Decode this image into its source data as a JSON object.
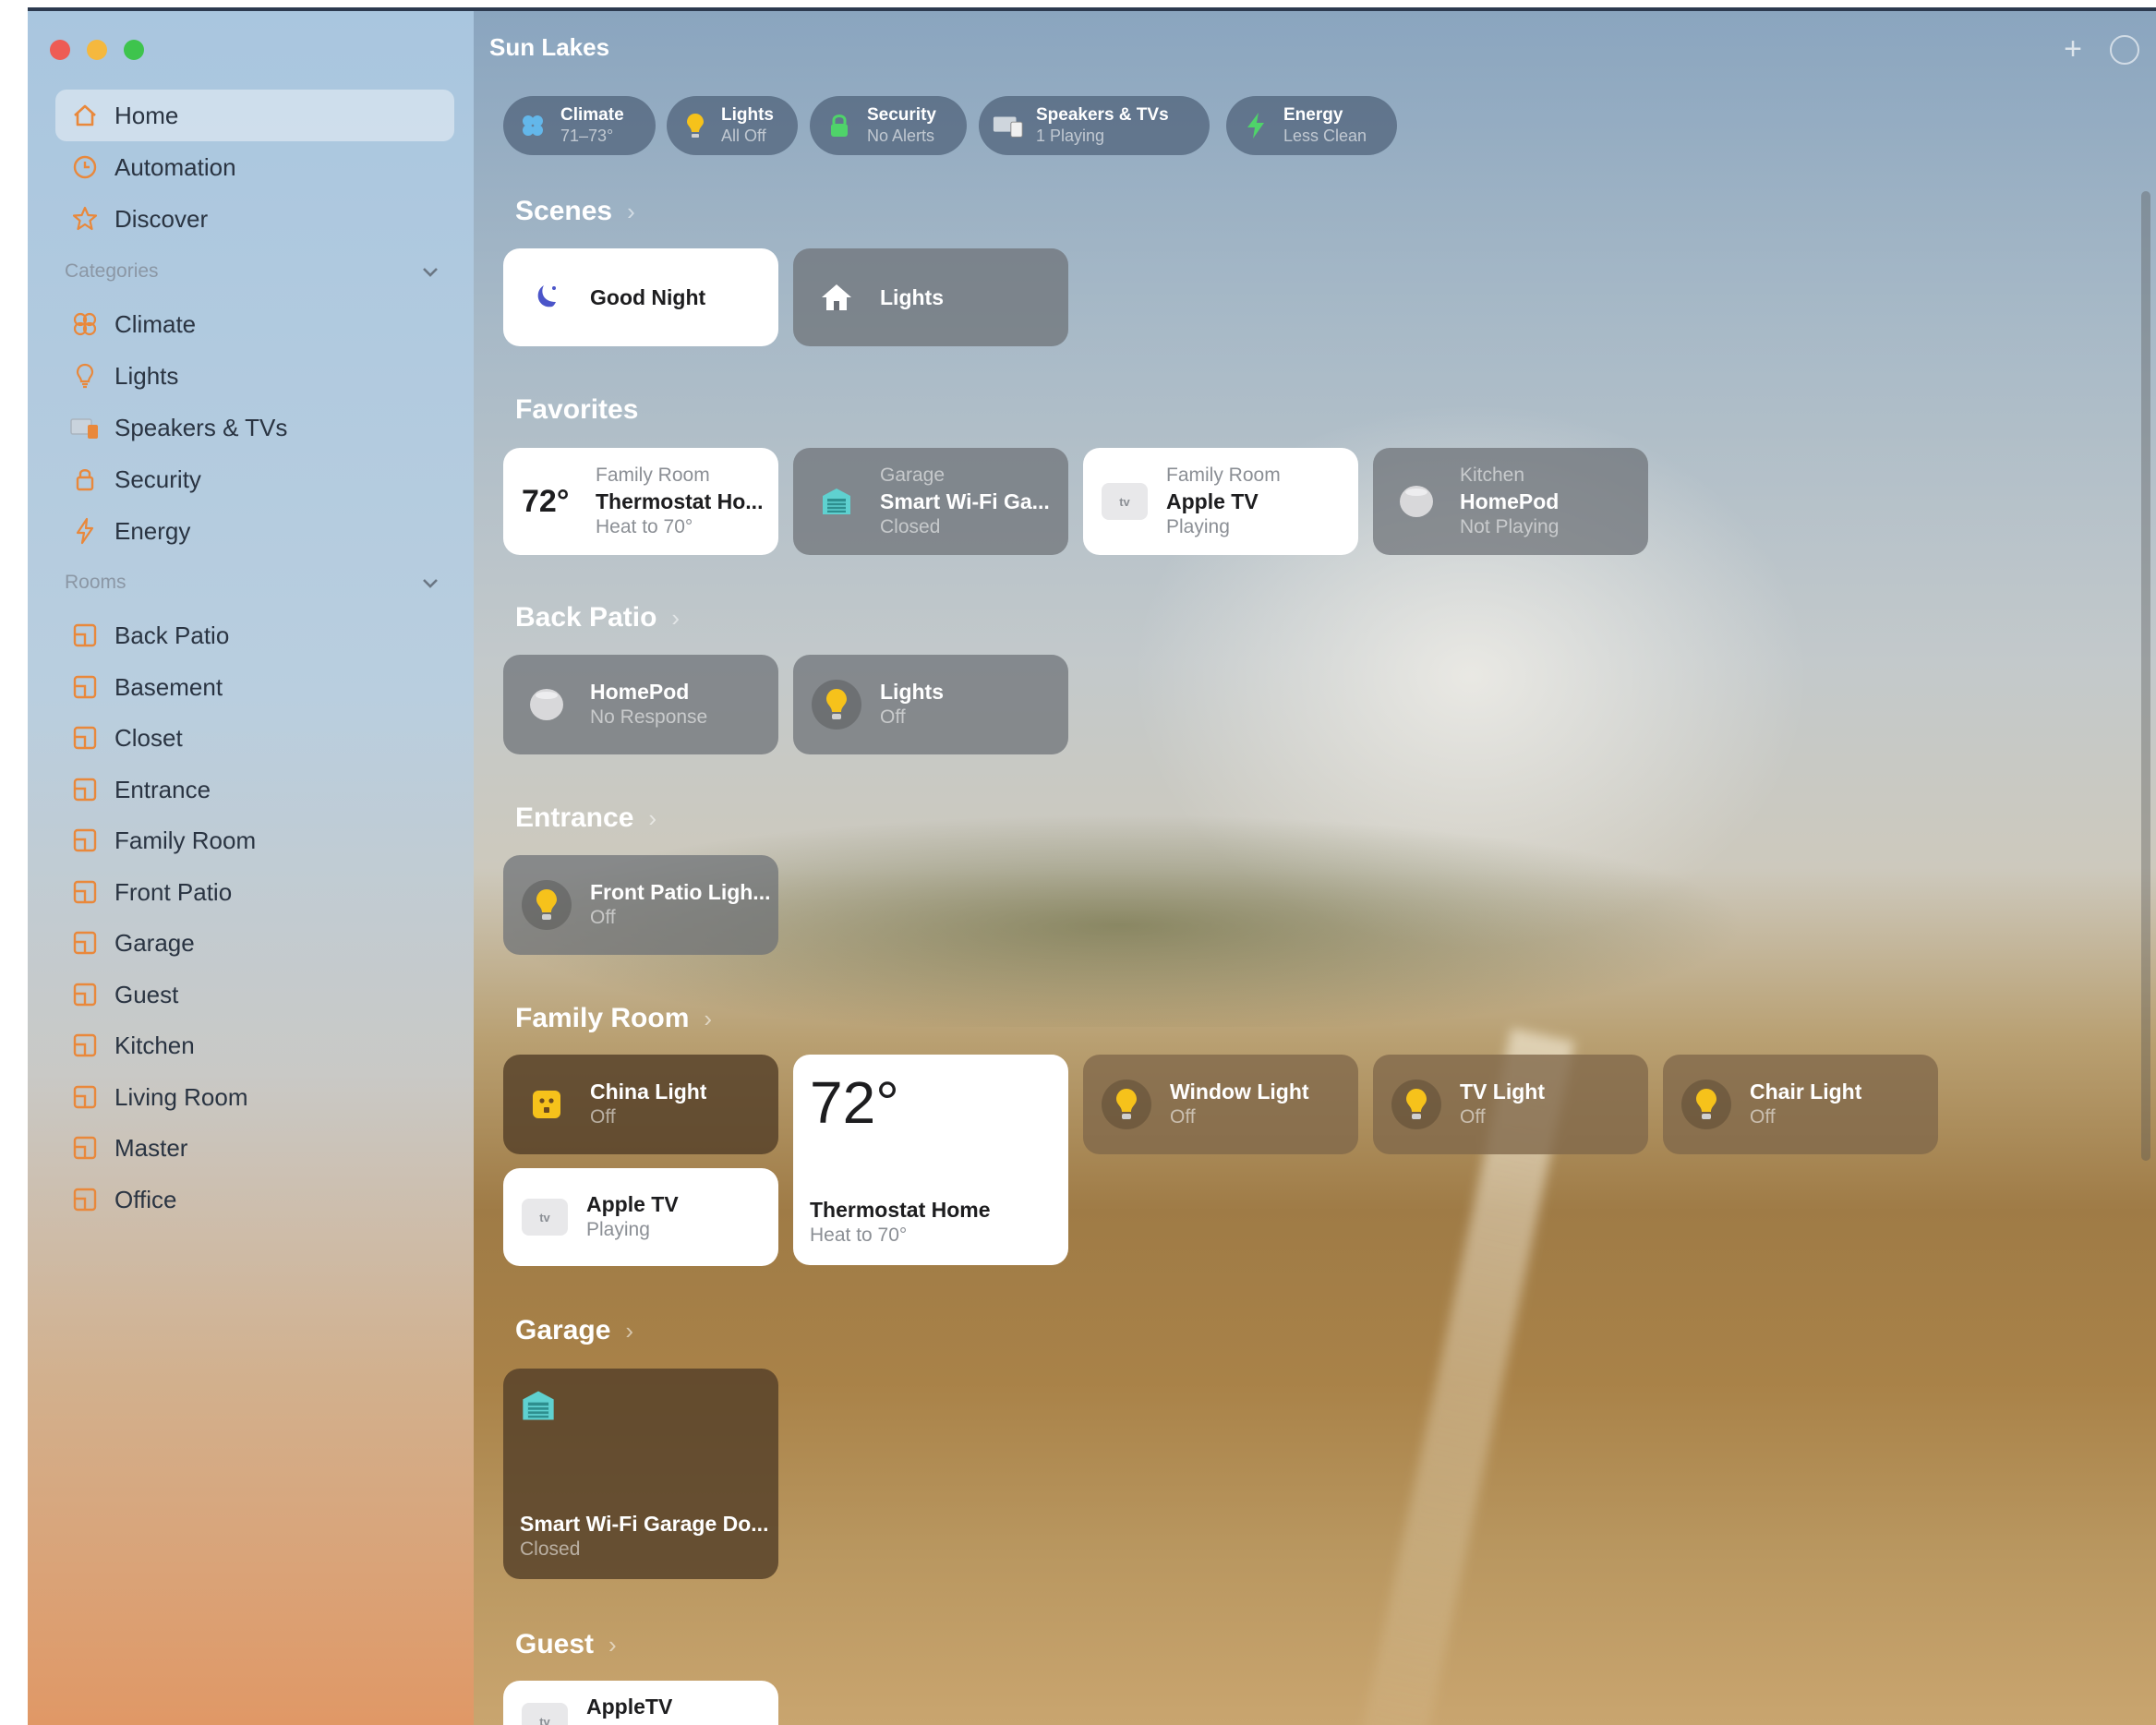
{
  "window": {
    "title": "Sun Lakes"
  },
  "sidebar": {
    "top_items": [
      {
        "label": "Home",
        "icon": "house-icon",
        "active": true
      },
      {
        "label": "Automation",
        "icon": "clock-icon"
      },
      {
        "label": "Discover",
        "icon": "star-icon"
      }
    ],
    "categories_header": "Categories",
    "categories": [
      {
        "label": "Climate",
        "icon": "fan-icon"
      },
      {
        "label": "Lights",
        "icon": "bulb-icon"
      },
      {
        "label": "Speakers & TVs",
        "icon": "speaker-icon"
      },
      {
        "label": "Security",
        "icon": "lock-icon"
      },
      {
        "label": "Energy",
        "icon": "bolt-icon"
      }
    ],
    "rooms_header": "Rooms",
    "rooms": [
      "Back Patio",
      "Basement",
      "Closet",
      "Entrance",
      "Family Room",
      "Front Patio",
      "Garage",
      "Guest",
      "Kitchen",
      "Living Room",
      "Master",
      "Office"
    ]
  },
  "status_pills": [
    {
      "title": "Climate",
      "sub": "71–73°",
      "icon": "fan-icon"
    },
    {
      "title": "Lights",
      "sub": "All Off",
      "icon": "bulb-icon"
    },
    {
      "title": "Security",
      "sub": "No Alerts",
      "icon": "lock-icon"
    },
    {
      "title": "Speakers & TVs",
      "sub": "1 Playing",
      "icon": "speaker-icon"
    },
    {
      "title": "Energy",
      "sub": "Less Clean",
      "icon": "bolt-icon"
    }
  ],
  "sections": {
    "scenes": "Scenes",
    "favorites": "Favorites",
    "back_patio": "Back Patio",
    "entrance": "Entrance",
    "family_room": "Family Room",
    "garage": "Garage",
    "guest": "Guest"
  },
  "scenes": [
    {
      "label": "Good Night",
      "icon": "moon-icon"
    },
    {
      "label": "Lights",
      "icon": "house-icon"
    }
  ],
  "favorites": [
    {
      "room": "Family Room",
      "name": "Thermostat Ho...",
      "status": "Heat to 70°",
      "temp": "72°"
    },
    {
      "room": "Garage",
      "name": "Smart Wi-Fi Ga...",
      "status": "Closed"
    },
    {
      "room": "Family Room",
      "name": "Apple TV",
      "status": "Playing",
      "badge": "tv"
    },
    {
      "room": "Kitchen",
      "name": "HomePod",
      "status": "Not Playing"
    }
  ],
  "back_patio": [
    {
      "name": "HomePod",
      "status": "No Response"
    },
    {
      "name": "Lights",
      "status": "Off"
    }
  ],
  "entrance": [
    {
      "name": "Front Patio Ligh...",
      "status": "Off"
    }
  ],
  "family_room": {
    "china_light": {
      "name": "China Light",
      "status": "Off"
    },
    "thermostat": {
      "temp": "72°",
      "name": "Thermostat Home",
      "status": "Heat to 70°"
    },
    "window_light": {
      "name": "Window Light",
      "status": "Off"
    },
    "tv_light": {
      "name": "TV Light",
      "status": "Off"
    },
    "chair_light": {
      "name": "Chair Light",
      "status": "Off"
    },
    "apple_tv": {
      "name": "Apple TV",
      "status": "Playing",
      "badge": "tv"
    }
  },
  "garage": [
    {
      "name": "Smart Wi-Fi Garage Do...",
      "status": "Closed"
    }
  ],
  "guest": [
    {
      "name": "AppleTV",
      "badge": "tv"
    }
  ],
  "colors": {
    "bulb": "#f6c21b",
    "accent_orange": "#e9883b",
    "garage_teal": "#5fd1d0",
    "moon": "#4b55c9"
  }
}
